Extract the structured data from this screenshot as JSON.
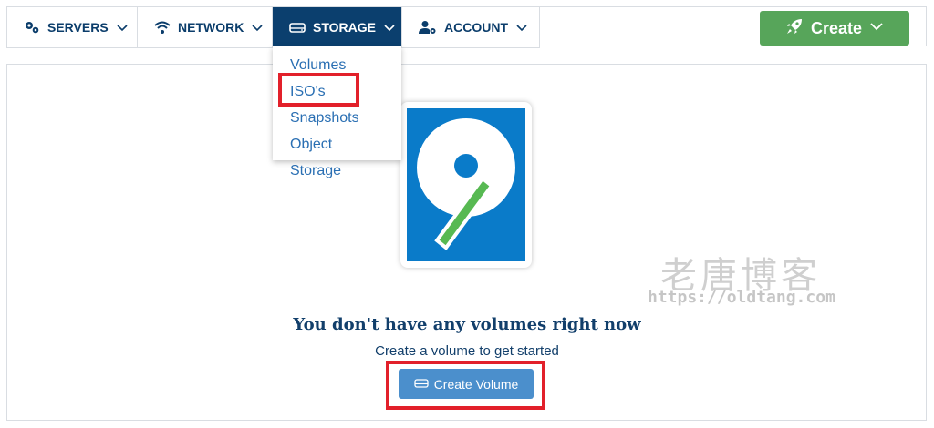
{
  "nav": {
    "tabs": [
      {
        "label": "SERVERS",
        "icon": "gears-icon"
      },
      {
        "label": "NETWORK",
        "icon": "wifi-icon"
      },
      {
        "label": "STORAGE",
        "icon": "drive-icon",
        "active": true
      },
      {
        "label": "ACCOUNT",
        "icon": "user-cog-icon"
      }
    ],
    "create_label": "Create"
  },
  "storage_menu": {
    "items": [
      "Volumes",
      "ISO's",
      "Snapshots",
      "Object Storage"
    ],
    "highlighted": "ISO's"
  },
  "empty_state": {
    "title": "You don't have any volumes right now",
    "subtitle": "Create a volume to get started",
    "button_label": "Create Volume"
  },
  "watermark": {
    "title": "老唐博客",
    "url": "https://oldtang.com"
  },
  "colors": {
    "nav_active_bg": "#0b3f6e",
    "create_green": "#57a55a",
    "button_blue": "#4b8fcc",
    "link_blue": "#2a6fb3",
    "highlight_red": "#e2202a",
    "illustration_blue": "#0a7bc9",
    "illustration_green": "#57b952"
  }
}
